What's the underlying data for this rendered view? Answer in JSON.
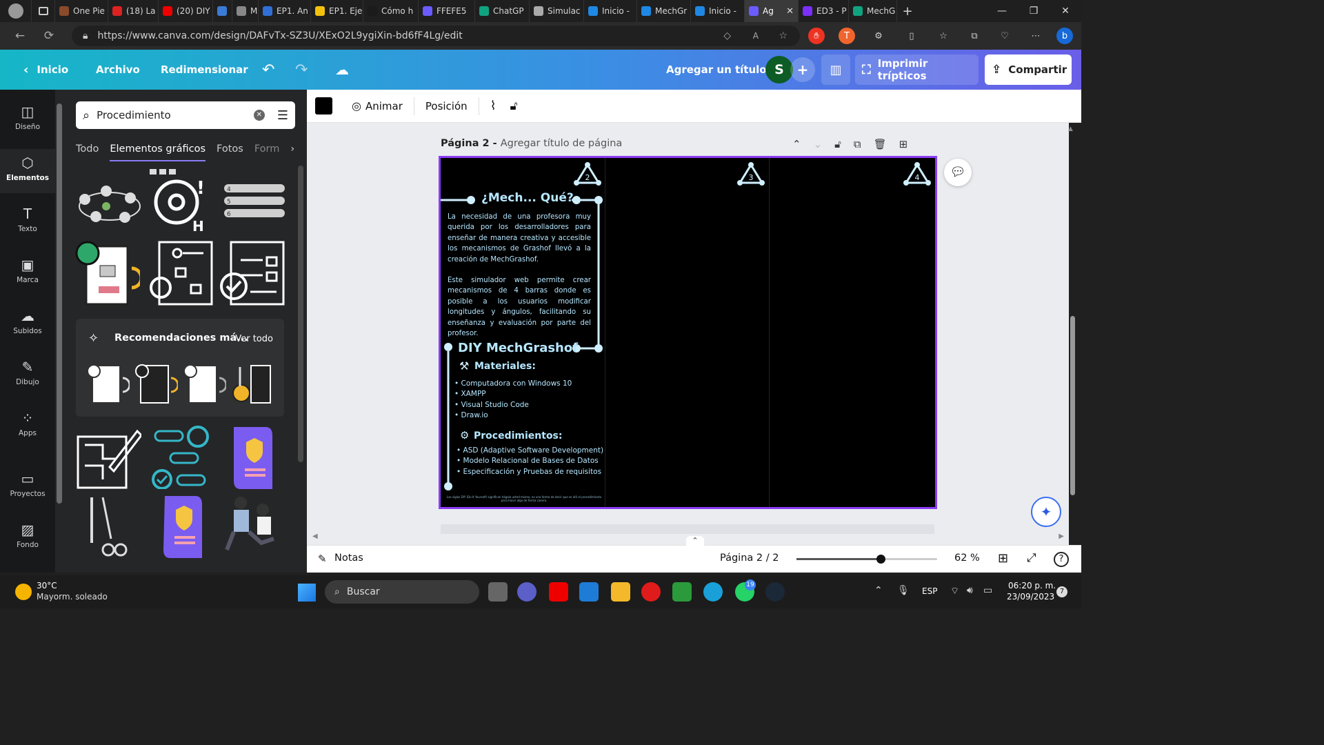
{
  "browser": {
    "tabs": [
      {
        "label": "One Pie",
        "color": "#8a4a2b"
      },
      {
        "label": "(18) La",
        "color": "#d22"
      },
      {
        "label": "(20) DIY",
        "color": "#e00"
      },
      {
        "label": "",
        "color": "#3a7bd5"
      },
      {
        "label": "Me",
        "color": "#888"
      },
      {
        "label": "EP1. An",
        "color": "#2f6fd6"
      },
      {
        "label": "EP1. Eje",
        "color": "#f4c20d"
      },
      {
        "label": "Cómo h",
        "color": "#1b1b1b"
      },
      {
        "label": "FFEFE5",
        "color": "#6a5cff"
      },
      {
        "label": "ChatGP",
        "color": "#10a37f"
      },
      {
        "label": "Simulac",
        "color": "#aaa"
      },
      {
        "label": "Inicio -",
        "color": "#1e88e5"
      },
      {
        "label": "MechGr",
        "color": "#1e88e5"
      },
      {
        "label": "Inicio -",
        "color": "#1e88e5"
      },
      {
        "label": "Ag",
        "color": "#6a5cff",
        "active": true
      },
      {
        "label": "ED3 - P",
        "color": "#7b2ff7"
      },
      {
        "label": "MechG",
        "color": "#10a37f"
      }
    ],
    "url": "https://www.canva.com/design/DAFvTx-SZ3U/XExO2L9ygiXin-bd6fF4Lg/edit"
  },
  "header": {
    "home": "Inicio",
    "file": "Archivo",
    "resize": "Redimensionar",
    "add_title": "Agregar un título",
    "avatar": "S",
    "print": "Imprimir trípticos",
    "share": "Compartir"
  },
  "rail": [
    {
      "label": "Diseño",
      "icon": "layout-icon"
    },
    {
      "label": "Elementos",
      "icon": "elements-icon",
      "active": true
    },
    {
      "label": "Texto",
      "icon": "text-icon"
    },
    {
      "label": "Marca",
      "icon": "brand-icon"
    },
    {
      "label": "Subidos",
      "icon": "upload-icon"
    },
    {
      "label": "Dibujo",
      "icon": "draw-icon"
    },
    {
      "label": "Apps",
      "icon": "apps-icon"
    },
    {
      "label": "Proyectos",
      "icon": "folder-icon"
    },
    {
      "label": "Fondo",
      "icon": "background-icon"
    }
  ],
  "panel": {
    "search_value": "Procedimiento",
    "tabs": [
      "Todo",
      "Elementos gráficos",
      "Fotos",
      "Form"
    ],
    "reco_title": "Recomendaciones má...",
    "see_all": "Ver todo"
  },
  "toolbar": {
    "animate": "Animar",
    "position": "Posición"
  },
  "page": {
    "head_bold": "Página 2 - ",
    "head_rest": "Agregar título de página",
    "numbers": [
      "2",
      "3",
      "4"
    ],
    "title1": "¿Mech... Qué?",
    "para1": "La necesidad de una profesora muy querida por los desarrolladores para enseñar de manera creativa y accesible los mecanismos de Grashof llevó a la creación de MechGrashof.",
    "para2": "Este simulador web permite crear mecanismos de 4 barras donde es posible a los usuarios modificar longitudes y ángulos, facilitando su enseñanza y evaluación por parte del profesor.",
    "title2": "DIY MechGrashof",
    "materials_title": "Materiales:",
    "materials": [
      "Computadora con Windows 10",
      "XAMPP",
      "Visual Studio Code",
      "Draw.io"
    ],
    "proc_title": "Procedimientos:",
    "procedures": [
      "ASD (Adaptive Software Development)",
      "Modelo Relacional de Bases de Datos",
      "Especificación y Pruebas de requisitos"
    ],
    "footnote": "Las siglas DIY (Do It Yourself) significan hágalo usted mismo, es una forma de decir que es útil el procedimiento para hacer algo de forma casera."
  },
  "bottom": {
    "notes": "Notas",
    "page_indicator": "Página 2 / 2",
    "zoom": "62 %",
    "zoom_level": 0.6
  },
  "taskbar": {
    "temp": "30°C",
    "weather": "Mayorm. soleado",
    "search": "Buscar",
    "lang": "ESP",
    "time": "06:20 p. m.",
    "date": "23/09/2023",
    "badge": "19",
    "notif": "7"
  }
}
